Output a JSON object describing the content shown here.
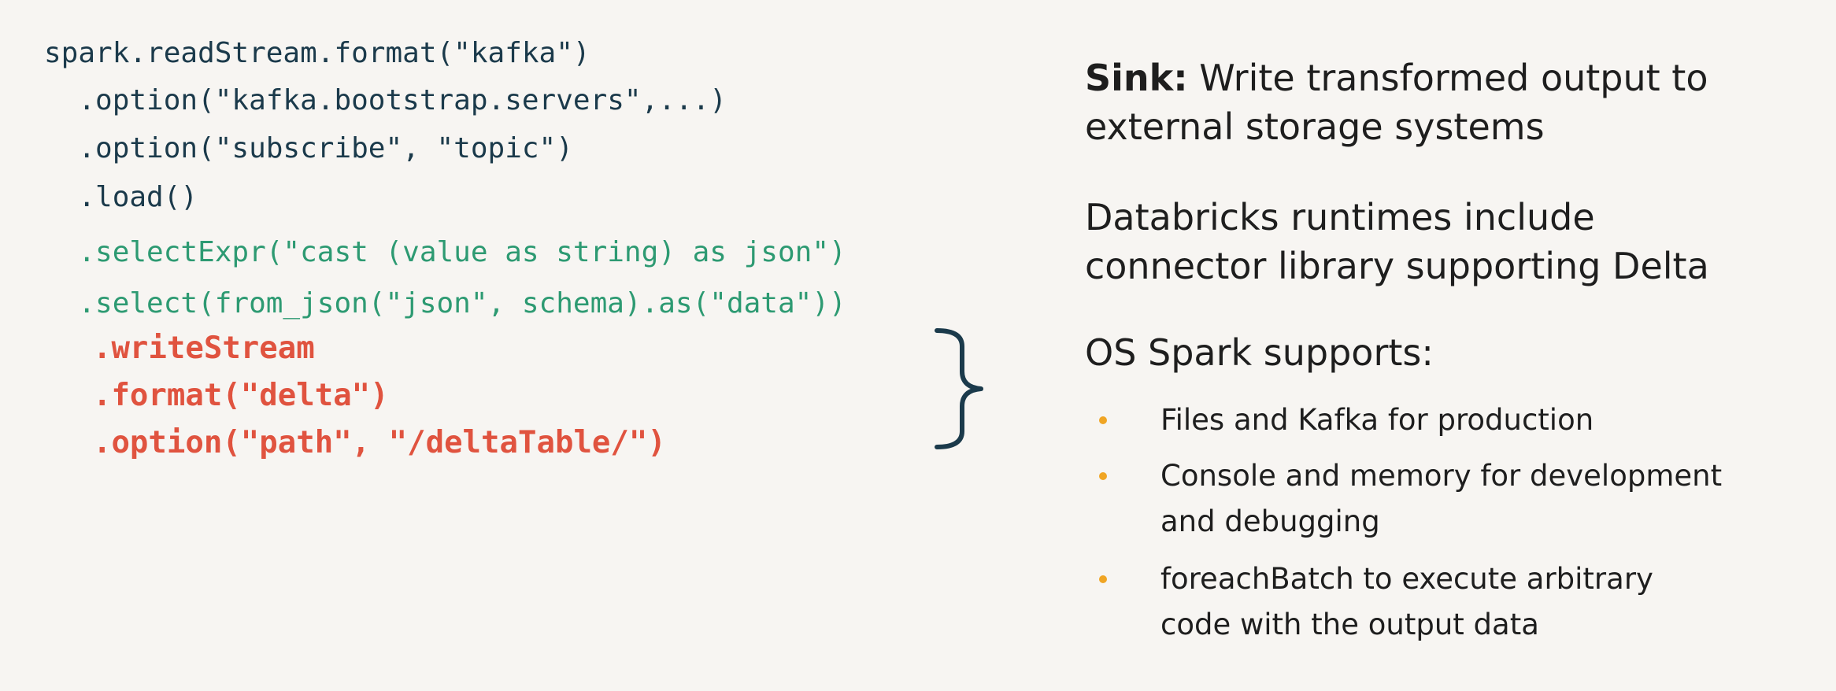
{
  "code": {
    "lines": [
      "spark.readStream.format(\"kafka\")",
      "  .option(\"kafka.bootstrap.servers\",...)",
      "  .option(\"subscribe\", \"topic\")",
      "  .load()",
      "  .selectExpr(\"cast (value as string) as json\")",
      "  .select(from_json(\"json\", schema).as(\"data\"))",
      "  .writeStream",
      "  .format(\"delta\")",
      "  .option(\"path\", \"/deltaTable/\")"
    ]
  },
  "sink": {
    "label": "Sink:",
    "description": " Write transformed output to external storage systems"
  },
  "databricks_note": "Databricks runtimes include connector library supporting Delta",
  "os_spark": {
    "heading": "OS Spark supports:",
    "items": [
      "Files and Kafka for production",
      "Console and memory for development and debugging",
      "foreachBatch to execute arbitrary code with the output data"
    ]
  },
  "colors": {
    "background": "#f7f5f2",
    "code_default": "#1b3a4b",
    "code_transform": "#2d9a72",
    "code_sink": "#e0533f",
    "bullet": "#f0a524"
  }
}
